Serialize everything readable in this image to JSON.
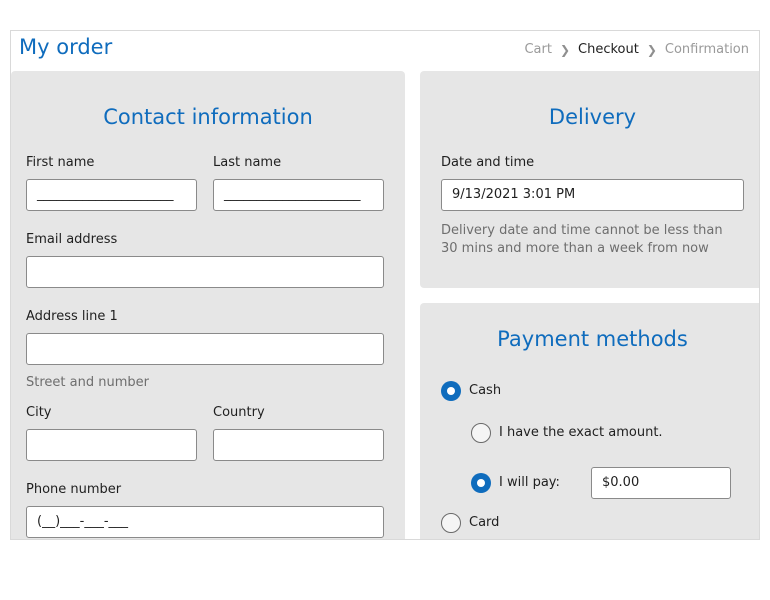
{
  "header": {
    "title": "My order",
    "breadcrumb": [
      "Cart",
      "Checkout",
      "Confirmation"
    ],
    "current_step": "Checkout"
  },
  "contact": {
    "title": "Contact information",
    "first_name": {
      "label": "First name",
      "value": "_____________________"
    },
    "last_name": {
      "label": "Last name",
      "value": "_____________________"
    },
    "email": {
      "label": "Email address",
      "value": ""
    },
    "address1": {
      "label": "Address line 1",
      "value": "",
      "hint": "Street and number"
    },
    "city": {
      "label": "City",
      "value": ""
    },
    "country": {
      "label": "Country",
      "value": ""
    },
    "phone": {
      "label": "Phone number",
      "value": "(__)___-___-___"
    }
  },
  "delivery": {
    "title": "Delivery",
    "date_label": "Date and time",
    "date_value": "9/13/2021 3:01 PM",
    "hint": "Delivery date and time cannot be less than 30 mins and more than a week from now"
  },
  "payment": {
    "title": "Payment methods",
    "options": [
      {
        "label": "Cash",
        "selected": true
      },
      {
        "label": "Card",
        "selected": false
      }
    ],
    "cash_options": [
      {
        "label": "I have the exact amount.",
        "selected": false
      },
      {
        "label": "I will pay:",
        "selected": true
      }
    ],
    "pay_amount": "$0.00"
  },
  "colors": {
    "accent": "#0f6cbd",
    "panel_bg": "#e6e6e6"
  },
  "icons": [
    "chevron-right-icon"
  ]
}
